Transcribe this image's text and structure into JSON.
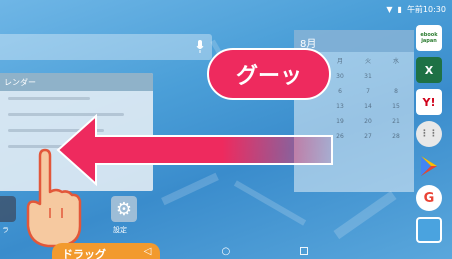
{
  "status_bar": {
    "time": "午前10:30"
  },
  "calendar_widget": {
    "header": "レンダー"
  },
  "month_widget": {
    "month": "8月",
    "weekdays": [
      "月",
      "火",
      "水"
    ],
    "rows": [
      [
        "30",
        "31",
        ""
      ],
      [
        "6",
        "7",
        "8"
      ],
      [
        "13",
        "14",
        "15"
      ],
      [
        "19",
        "20",
        "21"
      ],
      [
        "26",
        "27",
        "28"
      ]
    ]
  },
  "dock_apps": [
    {
      "label": "ebook japan",
      "color": "#2e7d32"
    },
    {
      "label": "X",
      "color": "#1e7145"
    },
    {
      "label": "Y!",
      "color": "#ffffff"
    },
    {
      "label": "",
      "color": "#e0e0e0"
    },
    {
      "label": "",
      "color": "#ffffff"
    },
    {
      "label": "G",
      "color": "#ffffff"
    },
    {
      "label": "",
      "color": "#4aa3df"
    }
  ],
  "bubble": {
    "text": "グーッ"
  },
  "settings_app": {
    "label": "設定"
  },
  "left_app": {
    "label": "ラ"
  },
  "bottom_banner": {
    "text": "ドラッグ"
  },
  "colors": {
    "accent": "#ee2a5e",
    "banner": "#f29a2e"
  }
}
